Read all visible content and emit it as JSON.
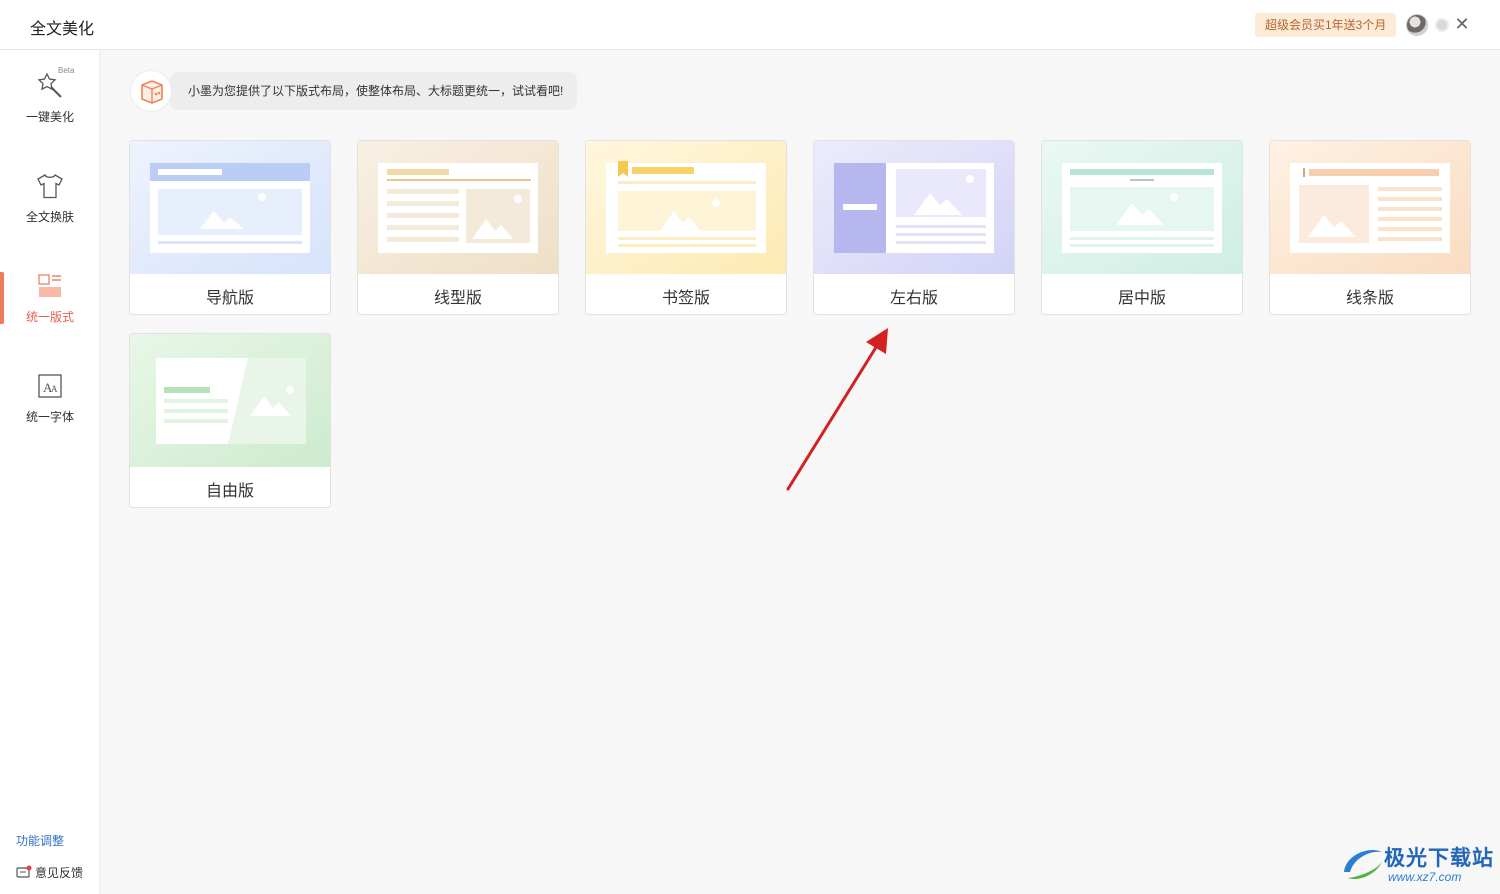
{
  "header": {
    "title": "全文美化",
    "promo_label": "超级会员买1年送3个月",
    "close_symbol": "✕"
  },
  "sidebar": {
    "items": [
      {
        "label": "一键美化",
        "icon": "magic-wand-icon",
        "badge": "Beta"
      },
      {
        "label": "全文换肤",
        "icon": "tshirt-icon"
      },
      {
        "label": "统一版式",
        "icon": "layout-icon",
        "active": true
      },
      {
        "label": "统一字体",
        "icon": "font-icon"
      }
    ],
    "function_adjust": "功能调整",
    "feedback": "意见反馈"
  },
  "tip": {
    "text": "小墨为您提供了以下版式布局，使整体布局、大标题更统一，试试看吧!"
  },
  "layouts": [
    {
      "label": "导航版",
      "color": "#dbe6fb"
    },
    {
      "label": "线型版",
      "color": "#f3e6d2"
    },
    {
      "label": "书签版",
      "color": "#fdf0c6"
    },
    {
      "label": "左右版",
      "color": "#dcdcf8"
    },
    {
      "label": "居中版",
      "color": "#d8f1ea"
    },
    {
      "label": "线条版",
      "color": "#fbe4cf"
    },
    {
      "label": "自由版",
      "color": "#d7f0d7"
    }
  ],
  "colors": {
    "accent": "#e8614a",
    "link": "#3470c8",
    "annotation_arrow": "#d42020"
  },
  "watermark": {
    "text": "极光下载站",
    "url": "www.xz7.com"
  }
}
